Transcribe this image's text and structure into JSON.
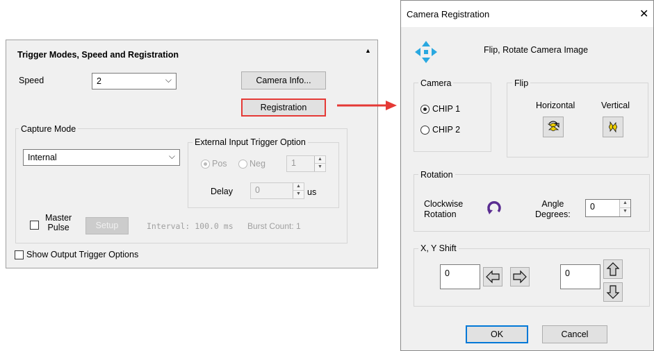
{
  "trigger_panel": {
    "title": "Trigger Modes, Speed and Registration",
    "speed_label": "Speed",
    "speed_value": "2",
    "camera_info_button": "Camera Info...",
    "registration_button": "Registration",
    "capture_mode": {
      "group_label": "Capture Mode",
      "mode_value": "Internal",
      "external_group_label": "External Input Trigger Option",
      "pos_label": "Pos",
      "neg_label": "Neg",
      "pos_neg_selected": "Pos",
      "count_value": "1",
      "delay_label": "Delay",
      "delay_value": "0",
      "delay_unit": "us",
      "master_pulse_label_1": "Master",
      "master_pulse_label_2": "Pulse",
      "setup_button": "Setup",
      "interval_text": "Interval: 100.0 ms",
      "burst_text": "Burst Count: 1"
    },
    "show_output_label": "Show Output Trigger Options"
  },
  "dialog": {
    "title": "Camera Registration",
    "close_glyph": "✕",
    "heading": "Flip, Rotate Camera Image",
    "camera_group": "Camera",
    "chip1": "CHIP 1",
    "chip2": "CHIP 2",
    "selected_chip": "CHIP 1",
    "flip_group": "Flip",
    "horizontal_label": "Horizontal",
    "vertical_label": "Vertical",
    "rotation_group": "Rotation",
    "clockwise_label_1": "Clockwise",
    "clockwise_label_2": "Rotation",
    "angle_label_1": "Angle",
    "angle_label_2": "Degrees:",
    "angle_value": "0",
    "shift_group": "X, Y Shift",
    "x_value": "0",
    "y_value": "0",
    "ok_button": "OK",
    "cancel_button": "Cancel"
  },
  "colors": {
    "callout_red": "#e53935",
    "move_icon_blue": "#29a8e0",
    "rotate_purple": "#5a2d91",
    "flip_yellow": "#f0d000"
  }
}
